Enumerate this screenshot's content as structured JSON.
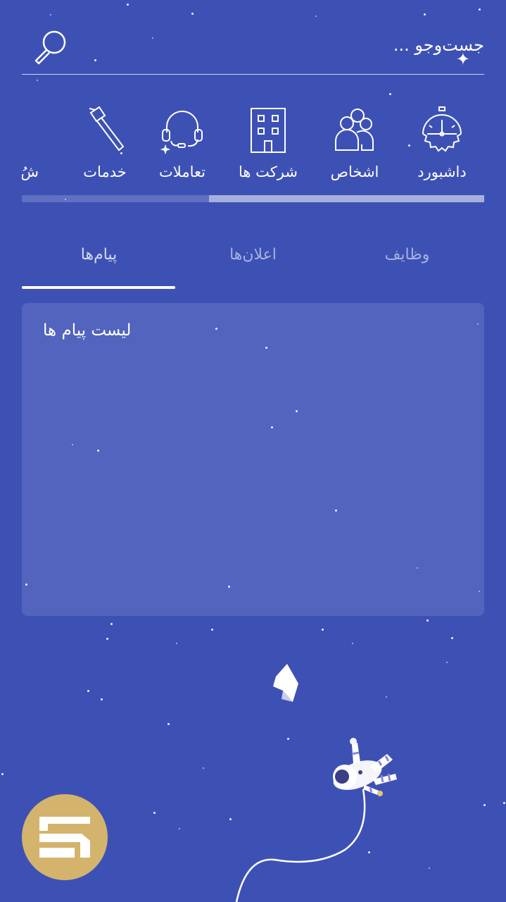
{
  "search": {
    "placeholder": "جست‌وجو ..."
  },
  "quick_nav": {
    "items": [
      {
        "label": "داشبورد",
        "icon": "dashboard-gauge-icon"
      },
      {
        "label": "اشخاص",
        "icon": "people-icon"
      },
      {
        "label": "شرکت ها",
        "icon": "building-icon"
      },
      {
        "label": "تعاملات",
        "icon": "headset-icon"
      },
      {
        "label": "خدمات",
        "icon": "hammer-icon"
      },
      {
        "label": "شُ",
        "icon": "clipboard-icon"
      }
    ],
    "scroll_position": 0.6
  },
  "tabs": [
    {
      "label": "وظایف",
      "active": false
    },
    {
      "label": "اعلان‌ها",
      "active": false
    },
    {
      "label": "پیام‌ها",
      "active": true
    }
  ],
  "panel": {
    "title": "لیست پیام ها"
  },
  "illustration": {
    "icon": "astronaut-icon"
  },
  "logo": {
    "icon": "brand-logo-icon"
  },
  "colors": {
    "background": "#3d51b5",
    "panel": "#5262bd",
    "logo": "#d4b36c",
    "text": "#ffffff"
  }
}
